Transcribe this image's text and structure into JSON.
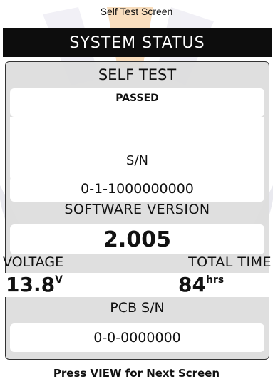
{
  "caption": "Self Test Screen",
  "title": "SYSTEM STATUS",
  "self_test": {
    "label": "SELF TEST",
    "result": "PASSED"
  },
  "serial_number": {
    "label": "S/N",
    "value": "0-1-1000000000"
  },
  "software_version": {
    "label": "SOFTWARE VERSION",
    "value": "2.005"
  },
  "voltage": {
    "label": "VOLTAGE",
    "value": "13.8",
    "unit": "V"
  },
  "total_time": {
    "label": "TOTAL TIME",
    "value": "84",
    "unit": "hrs"
  },
  "pcb_serial_number": {
    "label": "PCB S/N",
    "value": "0-0-0000000"
  },
  "footer": "Press VIEW for Next Screen",
  "colors": {
    "title_bar_bg": "#0d0d0d",
    "panel_bg": "#dcdcdc",
    "watermark_orange": "#f5c48a",
    "watermark_blue": "#c9cde8"
  }
}
